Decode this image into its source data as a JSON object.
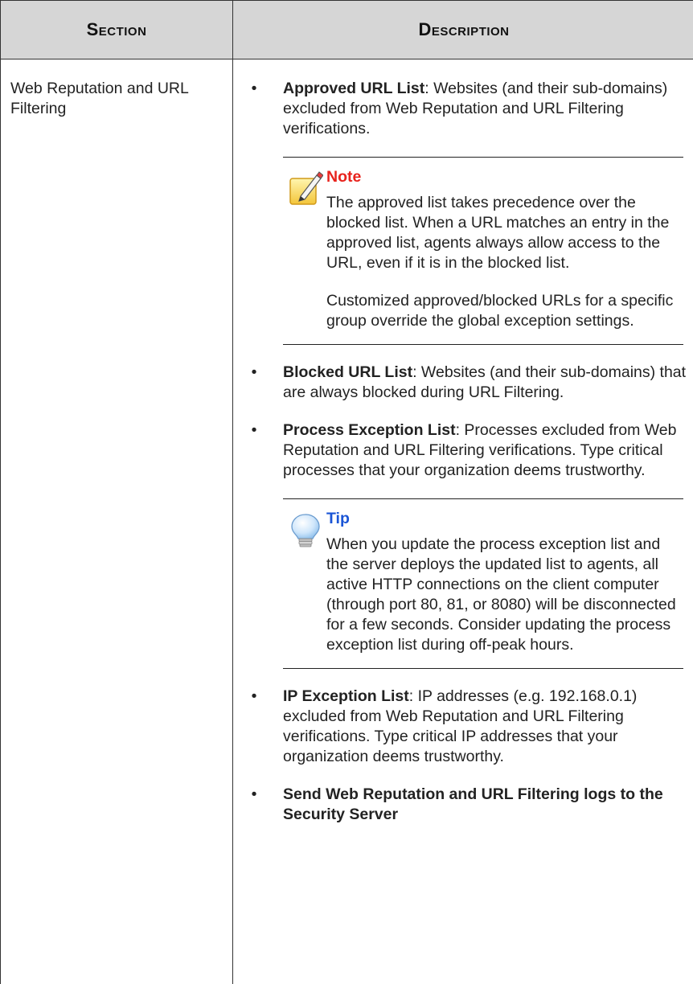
{
  "table": {
    "headers": {
      "section": "Section",
      "description": "Description"
    },
    "row": {
      "section": "Web Reputation and URL Filtering",
      "items": [
        {
          "term": "Approved URL List",
          "text": ": Websites (and their sub-domains) excluded from Web Reputation and URL Filtering verifications."
        },
        {
          "term": "Blocked URL List",
          "text": ": Websites (and their sub-domains) that are always blocked during URL Filtering."
        },
        {
          "term": "Process Exception List",
          "text": ": Processes excluded from Web Reputation and URL Filtering verifications. Type critical processes that your organization deems trustworthy."
        },
        {
          "term": "IP Exception List",
          "text": ": IP addresses (e.g. 192.168.0.1) excluded from Web Reputation and URL Filtering verifications. Type critical IP addresses that your organization deems trustworthy."
        },
        {
          "term": "Send Web Reputation and URL Filtering logs to the Security Server",
          "text": ""
        }
      ],
      "note": {
        "title": "Note",
        "icon": "note-pencil-icon",
        "paragraphs": [
          "The approved list takes precedence over the blocked list. When a URL matches an entry in the approved list, agents always allow access to the URL, even if it is in the blocked list.",
          "Customized approved/blocked URLs for a specific group override the global exception settings."
        ]
      },
      "tip": {
        "title": "Tip",
        "icon": "lightbulb-icon",
        "paragraphs": [
          "When you update the process exception list and the server deploys the updated list to agents, all active HTTP connections on the client computer (through port 80, 81, or 8080) will be disconnected for a few seconds. Consider updating the process exception list during off-peak hours."
        ]
      }
    }
  },
  "colors": {
    "header_bg": "#d6d6d6",
    "note_title": "#e8231d",
    "tip_title": "#1a55d6",
    "border": "#333333"
  }
}
